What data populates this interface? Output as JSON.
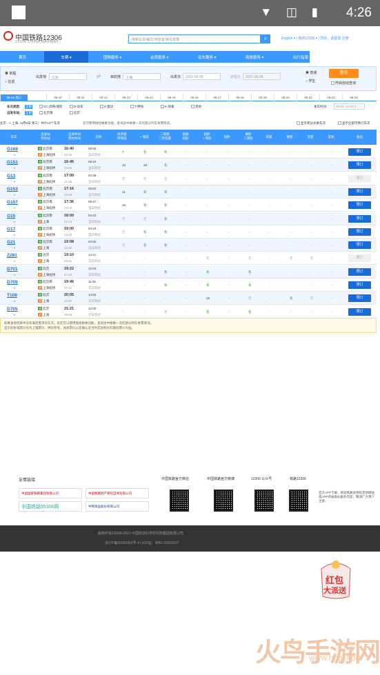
{
  "statusbar": {
    "time": "4:26",
    "icons": "▼ ◫ ▮"
  },
  "header": {
    "logo_title": "中国铁路12306",
    "logo_sub": "12306 CHINA RAILWAY",
    "search_placeholder": "搜索车票/餐饮/常旅客/相关规章",
    "links": "English ▾ | 我的12306 ▾ | 您好，请登录 注册"
  },
  "nav": [
    "首页",
    "车票 ▾",
    "团购服务 ▾",
    "会员服务 ▾",
    "站车服务 ▾",
    "商旅服务 ▾",
    "出行指南"
  ],
  "query": {
    "oneway": "单程",
    "round": "往返",
    "from_label": "出发地",
    "from": "北京",
    "to_label": "目的地",
    "to": "上海",
    "depart_label": "出发日",
    "depart": "2021-06-09",
    "return_label": "返程日",
    "return": "2021-06-09",
    "normal": "普通",
    "student": "学生",
    "search_btn": "查询",
    "auto": "开启自动查询"
  },
  "dates": [
    "06-09 周三",
    "06-10",
    "06-11",
    "06-12",
    "06-13",
    "06-14",
    "06-15",
    "06-16",
    "06-17",
    "06-18",
    "06-19",
    "06-20",
    "06-21",
    "06-22",
    "06-23"
  ],
  "filters": {
    "type_label": "车次类型:",
    "type_all": "全部",
    "types": [
      "GC-高铁/城际",
      "D-动车",
      "Z-直达",
      "T-特快",
      "K-快速",
      "其他"
    ],
    "from_label": "出发车站:",
    "from_all": "全部",
    "from_stations": [
      "北京南",
      "北京"
    ],
    "to_label": "到达车站:",
    "to_all": "全部",
    "to_stations": [
      "上海虹桥",
      "上海"
    ],
    "time_label": "发车时间:",
    "time_value": "00:00--24:00"
  },
  "info": {
    "route": "北京 --> 上海（6月9日 周三）共计13个车次",
    "tip": "您可使用接续换乘功能，查询途中换乘一次的部分列车余票情况。",
    "opt1": "显示积分兑换车次",
    "opt2": "显示全部可预订车次"
  },
  "table_headers": [
    "车次",
    "出发站\n到达站",
    "出发时间\n到达时间",
    "历时",
    "商务座\n特等座",
    "一等座",
    "二等座\n二等包座",
    "高级\n软卧",
    "软卧\n一等卧",
    "动卧",
    "硬卧\n二等卧",
    "软座",
    "硬座",
    "无座",
    "其他",
    "备注"
  ],
  "trains": [
    {
      "no": "G169",
      "from": "北京南",
      "to": "上海虹桥",
      "dep": "16:40",
      "arr": "22:35",
      "dur": "05:55",
      "day": "当日到达",
      "seats": [
        "7",
        "有",
        "有",
        "--",
        "--",
        "--",
        "--",
        "--",
        "--",
        "--",
        "--"
      ],
      "book": true
    },
    {
      "no": "G151",
      "from": "北京南",
      "to": "上海虹桥",
      "dep": "16:45",
      "arr": "22:55",
      "dur": "06:10",
      "day": "当日到达",
      "seats": [
        "10",
        "18",
        "有",
        "--",
        "--",
        "--",
        "--",
        "--",
        "--",
        "--",
        "--"
      ],
      "book": true
    },
    {
      "no": "G13",
      "from": "北京南",
      "to": "上海虹桥",
      "dep": "17:00",
      "arr": "21:36",
      "dur": "04:36",
      "day": "当日到达",
      "seats": [
        "无",
        "无",
        "无",
        "--",
        "--",
        "--",
        "--",
        "--",
        "--",
        "--",
        "--"
      ],
      "book": false
    },
    {
      "no": "G153",
      "from": "北京南",
      "to": "上海虹桥",
      "dep": "17:16",
      "arr": "23:08",
      "dur": "05:52",
      "day": "当日到达",
      "seats": [
        "11",
        "有",
        "有",
        "--",
        "--",
        "--",
        "--",
        "--",
        "--",
        "--",
        "--"
      ],
      "book": true
    },
    {
      "no": "G157",
      "from": "北京南",
      "to": "上海虹桥",
      "dep": "17:36",
      "arr": "23:23",
      "dur": "05:47",
      "day": "当日到达",
      "seats": [
        "10",
        "有",
        "有",
        "--",
        "--",
        "--",
        "--",
        "--",
        "--",
        "--",
        "--"
      ],
      "book": true
    },
    {
      "no": "G15",
      "from": "北京南",
      "to": "上海",
      "dep": "18:00",
      "arr": "22:43",
      "dur": "04:43",
      "day": "当日到达",
      "seats": [
        "无",
        "无",
        "有",
        "--",
        "--",
        "--",
        "--",
        "--",
        "--",
        "--",
        "--"
      ],
      "book": true
    },
    {
      "no": "G17",
      "from": "北京南",
      "to": "上海虹桥",
      "dep": "19:00",
      "arr": "23:18",
      "dur": "04:18",
      "day": "当日到达",
      "seats": [
        "无",
        "有",
        "有",
        "--",
        "--",
        "--",
        "--",
        "--",
        "--",
        "--",
        "--"
      ],
      "book": true
    },
    {
      "no": "G21",
      "from": "北京南",
      "to": "上海",
      "dep": "19:08",
      "arr": "23:40",
      "dur": "04:32",
      "day": "当日到达",
      "seats": [
        "无",
        "有",
        "有",
        "--",
        "--",
        "--",
        "--",
        "--",
        "--",
        "--",
        "--"
      ],
      "book": true
    },
    {
      "no": "Z281",
      "from": "北京",
      "to": "上海",
      "dep": "19:10",
      "arr": "09:51",
      "dur": "14:41",
      "day": "次日到达",
      "seats": [
        "--",
        "--",
        "--",
        "--",
        "无",
        "--",
        "无",
        "--",
        "无",
        "无",
        "--"
      ],
      "book": false
    },
    {
      "no": "D701",
      "from": "北京",
      "to": "上海虹桥",
      "dep": "19:22",
      "arr": "07:25",
      "dur": "12:03",
      "day": "次日到达",
      "seats": [
        "--",
        "--",
        "有",
        "--",
        "有",
        "--",
        "有",
        "--",
        "--",
        "--",
        "--"
      ],
      "book": true
    },
    {
      "no": "D709",
      "from": "北京南",
      "to": "上海虹桥",
      "dep": "19:46",
      "arr": "07:21",
      "dur": "11:35",
      "day": "次日到达",
      "seats": [
        "--",
        "--",
        "有",
        "--",
        "有",
        "--",
        "有",
        "--",
        "--",
        "--",
        "--"
      ],
      "book": true
    },
    {
      "no": "T109",
      "from": "北京",
      "to": "上海",
      "dep": "20:05",
      "arr": "11:00",
      "dur": "14:55",
      "day": "次日到达",
      "seats": [
        "--",
        "--",
        "--",
        "--",
        "15",
        "--",
        "无",
        "--",
        "有",
        "无",
        "--"
      ],
      "book": true
    },
    {
      "no": "D705",
      "from": "北京",
      "to": "上海",
      "dep": "21:21",
      "arr": "09:06",
      "dur": "12:00",
      "day": "次日到达",
      "seats": [
        "--",
        "--",
        "无",
        "--",
        "有",
        "--",
        "有",
        "--",
        "--",
        "--",
        "--"
      ],
      "book": true
    }
  ],
  "book_label": "预订",
  "notice": [
    "如果查询结果中没有满足需求的车次，您还可以使用接续换乘功能，查询途中换乘一次的部分列车余票情况。",
    "显示的卧铺票价均为上铺票价，供您参考。具体票价以您确认支付时实际购买的铺别票价为准。"
  ],
  "footer": {
    "links_title": "友情链接",
    "links": [
      "中国国家铁路集团有限公司",
      "中国铁路财产保险自保有限公司",
      "中国铁路95306网",
      "中铁快运股份有限公司"
    ],
    "qr_titles": [
      "中国铁路官方微信",
      "中国铁路官方微博",
      "12306 公众号",
      "铁路12306"
    ],
    "app_tip": "官方APP下载，目前铁路未授权其他网站或APP开展类似服务内容，敬请广大用户注意。",
    "copyright": "版权所有©2008-2021 中国铁道科学研究院集团有限公司",
    "icp": "京ICP备05020493号-4 | ICP证：京B2-20202537"
  },
  "promo": {
    "line1": "红包",
    "line2": "大派送"
  },
  "watermark": {
    "main": "火鸟手游网",
    "url": "www.hnqj.com"
  }
}
